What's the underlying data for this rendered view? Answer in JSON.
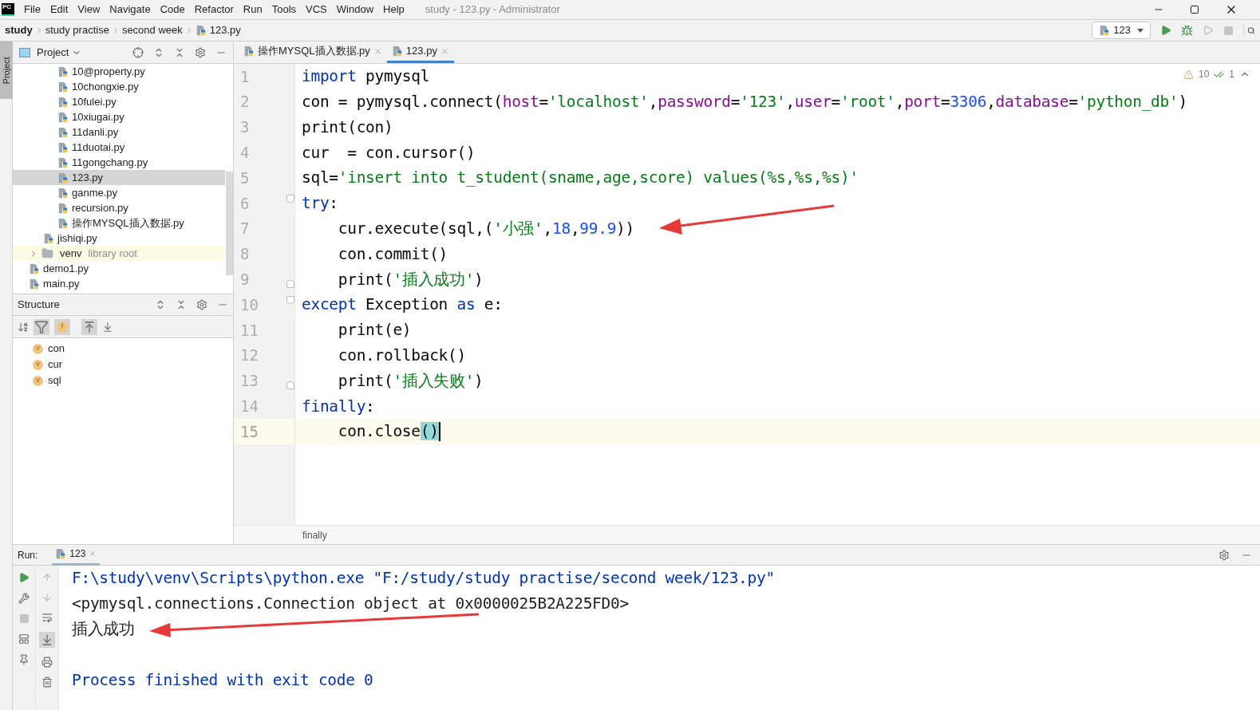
{
  "menu_bar": {
    "logo": "PC",
    "items": [
      "File",
      "Edit",
      "View",
      "Navigate",
      "Code",
      "Refactor",
      "Run",
      "Tools",
      "VCS",
      "Window",
      "Help"
    ],
    "title": "study - 123.py - Administrator"
  },
  "breadcrumbs": [
    "study",
    "study practise",
    "second week",
    "123.py"
  ],
  "run_config": {
    "label": "123"
  },
  "side_strip": {
    "label": "Project"
  },
  "project_panel": {
    "title": "Project",
    "tree": [
      {
        "children": [
          {
            "children": [
              {
                "label": "10@property.py",
                "selected": false
              },
              {
                "label": "10chongxie.py",
                "selected": false
              },
              {
                "label": "10fulei.py",
                "selected": false
              },
              {
                "label": "10xiugai.py",
                "selected": false
              },
              {
                "label": "11danli.py",
                "selected": false
              },
              {
                "label": "11duotai.py",
                "selected": false
              },
              {
                "label": "11gongchang.py",
                "selected": false
              },
              {
                "label": "123.py",
                "selected": true
              },
              {
                "label": "ganme.py",
                "selected": false
              },
              {
                "label": "recursion.py",
                "selected": false
              },
              {
                "label": "操作MYSQL插入数据.py",
                "selected": false
              }
            ]
          },
          {
            "label": "jishiqi.py",
            "selected": false
          }
        ]
      },
      {
        "label": "venv",
        "kind": "folder",
        "hint": "library root",
        "expanded": false,
        "selected": false
      },
      {
        "label": "demo1.py",
        "selected": false
      },
      {
        "label": "main.py",
        "selected": false
      }
    ]
  },
  "structure_panel": {
    "title": "Structure",
    "toolbar_letter": "f",
    "items": [
      {
        "badge": "v",
        "label": "con"
      },
      {
        "badge": "v",
        "label": "cur"
      },
      {
        "badge": "v",
        "label": "sql"
      }
    ]
  },
  "tabs": [
    {
      "label": "操作MYSQL插入数据.py",
      "selected": false
    },
    {
      "label": "123.py",
      "selected": true
    }
  ],
  "inspections": {
    "warnings": "10",
    "weak_warnings": "1"
  },
  "editor": {
    "lines": [
      {
        "number": "1",
        "current": false,
        "fold_start": false,
        "fold_end": false,
        "tokens": [
          {
            "kind": "keyword",
            "text": "import"
          },
          {
            "kind": "plain",
            "text": " pymysql"
          }
        ]
      },
      {
        "number": "2",
        "current": false,
        "fold_start": false,
        "fold_end": false,
        "tokens": [
          {
            "kind": "plain",
            "text": "con = pymysql.connect("
          },
          {
            "kind": "param",
            "text": "host"
          },
          {
            "kind": "plain",
            "text": "="
          },
          {
            "kind": "string",
            "text": "'localhost'"
          },
          {
            "kind": "plain",
            "text": ","
          },
          {
            "kind": "param",
            "text": "password"
          },
          {
            "kind": "plain",
            "text": "="
          },
          {
            "kind": "string",
            "text": "'123'"
          },
          {
            "kind": "plain",
            "text": ","
          },
          {
            "kind": "param",
            "text": "user"
          },
          {
            "kind": "plain",
            "text": "="
          },
          {
            "kind": "string",
            "text": "'root'"
          },
          {
            "kind": "plain",
            "text": ","
          },
          {
            "kind": "param",
            "text": "port"
          },
          {
            "kind": "plain",
            "text": "="
          },
          {
            "kind": "number",
            "text": "3306"
          },
          {
            "kind": "plain",
            "text": ","
          },
          {
            "kind": "param",
            "text": "database"
          },
          {
            "kind": "plain",
            "text": "="
          },
          {
            "kind": "string",
            "text": "'python_db'"
          },
          {
            "kind": "plain",
            "text": ")"
          }
        ]
      },
      {
        "number": "3",
        "current": false,
        "fold_start": false,
        "fold_end": false,
        "tokens": [
          {
            "kind": "plain",
            "text": "print(con)"
          }
        ]
      },
      {
        "number": "4",
        "current": false,
        "fold_start": false,
        "fold_end": false,
        "tokens": [
          {
            "kind": "plain",
            "text": "cur  = con.cursor()"
          }
        ]
      },
      {
        "number": "5",
        "current": false,
        "fold_start": false,
        "fold_end": false,
        "tokens": [
          {
            "kind": "plain",
            "text": "sql="
          },
          {
            "kind": "string",
            "text": "'insert into t_student(sname,age,score) values(%s,%s,%s)'"
          }
        ]
      },
      {
        "number": "6",
        "current": false,
        "fold_start": true,
        "fold_end": false,
        "tokens": [
          {
            "kind": "keyword",
            "text": "try"
          },
          {
            "kind": "plain",
            "text": ":"
          }
        ]
      },
      {
        "number": "7",
        "current": false,
        "fold_start": false,
        "fold_end": false,
        "tokens": [
          {
            "kind": "plain",
            "text": "    cur.execute(sql,("
          },
          {
            "kind": "string",
            "text": "'小强'"
          },
          {
            "kind": "plain",
            "text": ","
          },
          {
            "kind": "number",
            "text": "18"
          },
          {
            "kind": "plain",
            "text": ","
          },
          {
            "kind": "number",
            "text": "99.9"
          },
          {
            "kind": "plain",
            "text": "))"
          }
        ]
      },
      {
        "number": "8",
        "current": false,
        "fold_start": false,
        "fold_end": false,
        "tokens": [
          {
            "kind": "plain",
            "text": "    con.commit()"
          }
        ]
      },
      {
        "number": "9",
        "current": false,
        "fold_start": false,
        "fold_end": true,
        "tokens": [
          {
            "kind": "plain",
            "text": "    print("
          },
          {
            "kind": "string",
            "text": "'插入成功'"
          },
          {
            "kind": "plain",
            "text": ")"
          }
        ]
      },
      {
        "number": "10",
        "current": false,
        "fold_start": true,
        "fold_end": false,
        "tokens": [
          {
            "kind": "keyword",
            "text": "except"
          },
          {
            "kind": "plain",
            "text": " Exception "
          },
          {
            "kind": "keyword",
            "text": "as"
          },
          {
            "kind": "plain",
            "text": " e:"
          }
        ]
      },
      {
        "number": "11",
        "current": false,
        "fold_start": false,
        "fold_end": false,
        "tokens": [
          {
            "kind": "plain",
            "text": "    print(e)"
          }
        ]
      },
      {
        "number": "12",
        "current": false,
        "fold_start": false,
        "fold_end": false,
        "tokens": [
          {
            "kind": "plain",
            "text": "    con.rollback()"
          }
        ]
      },
      {
        "number": "13",
        "current": false,
        "fold_start": false,
        "fold_end": true,
        "tokens": [
          {
            "kind": "plain",
            "text": "    print("
          },
          {
            "kind": "string",
            "text": "'插入失败'"
          },
          {
            "kind": "plain",
            "text": ")"
          }
        ]
      },
      {
        "number": "14",
        "current": false,
        "fold_start": false,
        "fold_end": false,
        "tokens": [
          {
            "kind": "keyword",
            "text": "finally"
          },
          {
            "kind": "plain",
            "text": ":"
          }
        ]
      },
      {
        "number": "15",
        "current": true,
        "fold_start": false,
        "fold_end": false,
        "tokens": [
          {
            "kind": "plain",
            "text": "    con.close"
          },
          {
            "kind": "brace_match",
            "text": "()"
          }
        ]
      }
    ]
  },
  "editor_breadcrumb": "finally",
  "run_panel": {
    "title": "Run:",
    "tab": "123",
    "console": [
      {
        "kind": "system",
        "text": "F:\\study\\venv\\Scripts\\python.exe \"F:/study/study practise/second week/123.py\""
      },
      {
        "kind": "output",
        "text": "<pymysql.connections.Connection object at 0x0000025B2A225FD0>"
      },
      {
        "kind": "output",
        "text": "插入成功"
      },
      {
        "kind": "blank"
      },
      {
        "kind": "system",
        "text": "Process finished with exit code 0"
      }
    ]
  }
}
